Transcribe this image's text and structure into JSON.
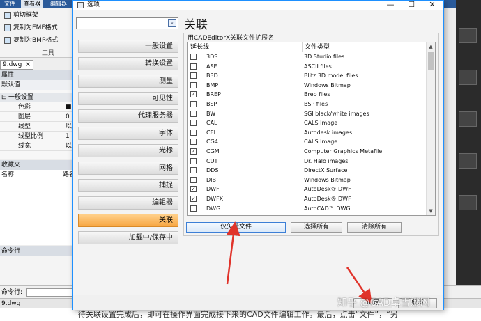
{
  "app": {
    "ribbon_tabs": [
      "文件",
      "查看器",
      "编辑器"
    ],
    "ribbon_items": [
      "剪切框架",
      "复制为EMF格式",
      "复制为BMP格式"
    ],
    "ribbon_group": "工具",
    "doc_tab": "9.dwg",
    "props": {
      "title": "属性",
      "subtitle": "默认值",
      "section": "一般设置",
      "rows": [
        {
          "key": "色彩",
          "val": "■"
        },
        {
          "key": "图层",
          "val": "0"
        },
        {
          "key": "线型",
          "val": "以I"
        },
        {
          "key": "线型比例",
          "val": "1"
        },
        {
          "key": "线宽",
          "val": "以I"
        }
      ]
    },
    "favorites": {
      "title": "收藏夹",
      "col_name": "名称",
      "col_path": "路名"
    },
    "cmd": {
      "title": "命令行",
      "label": "命令行:"
    },
    "status": "9.dwg",
    "caption": "待关联设置完成后，即可在操作界面完成接下来的CAD文件编辑工作。最后，点击“文件”，“另"
  },
  "dialog": {
    "title": "选项",
    "heading": "关联",
    "group_label": "用CADEditorX关联文件扩展名",
    "col_ext": "延长线",
    "col_type": "文件类型",
    "nav": [
      {
        "label": "一般设置",
        "active": false
      },
      {
        "label": "转换设置",
        "active": false
      },
      {
        "label": "测量",
        "active": false
      },
      {
        "label": "可见性",
        "active": false
      },
      {
        "label": "代理服务器",
        "active": false
      },
      {
        "label": "字体",
        "active": false
      },
      {
        "label": "光标",
        "active": false
      },
      {
        "label": "网格",
        "active": false
      },
      {
        "label": "捕捉",
        "active": false
      },
      {
        "label": "编辑器",
        "active": false
      },
      {
        "label": "关联",
        "active": true
      },
      {
        "label": "加载中/保存中",
        "active": false
      }
    ],
    "rows": [
      {
        "ext": "3DS",
        "type": "3D Studio files",
        "checked": false
      },
      {
        "ext": "ASE",
        "type": "ASCII files",
        "checked": false
      },
      {
        "ext": "B3D",
        "type": "Blitz 3D model files",
        "checked": false
      },
      {
        "ext": "BMP",
        "type": "Windows Bitmap",
        "checked": false
      },
      {
        "ext": "BREP",
        "type": "Brep files",
        "checked": true
      },
      {
        "ext": "BSP",
        "type": "BSP files",
        "checked": false
      },
      {
        "ext": "BW",
        "type": "SGI black/white images",
        "checked": false
      },
      {
        "ext": "CAL",
        "type": "CALS Image",
        "checked": false
      },
      {
        "ext": "CEL",
        "type": "Autodesk images",
        "checked": false
      },
      {
        "ext": "CG4",
        "type": "CALS Image",
        "checked": false
      },
      {
        "ext": "CGM",
        "type": "Computer Graphics Metafile",
        "checked": true
      },
      {
        "ext": "CUT",
        "type": "Dr. Halo images",
        "checked": false
      },
      {
        "ext": "DDS",
        "type": "DirectX Surface",
        "checked": false
      },
      {
        "ext": "DIB",
        "type": "Windows Bitmap",
        "checked": false
      },
      {
        "ext": "DWF",
        "type": "AutoDesk® DWF",
        "checked": true
      },
      {
        "ext": "DWFX",
        "type": "AutoDesk® DWF",
        "checked": true
      },
      {
        "ext": "DWG",
        "type": "AutoCAD™ DWG",
        "checked": false
      }
    ],
    "buttons": {
      "vector_only": "仅矢量文件",
      "select_all": "选择所有",
      "clear_all": "清除所有"
    },
    "footer": {
      "ok": "确定",
      "cancel": "取消"
    }
  },
  "watermark": "知乎 @CAD卓雪娜网",
  "colors": {
    "accent_active": "#f7a642",
    "annotation": "#e0332a",
    "window_border": "#1e90ff"
  }
}
